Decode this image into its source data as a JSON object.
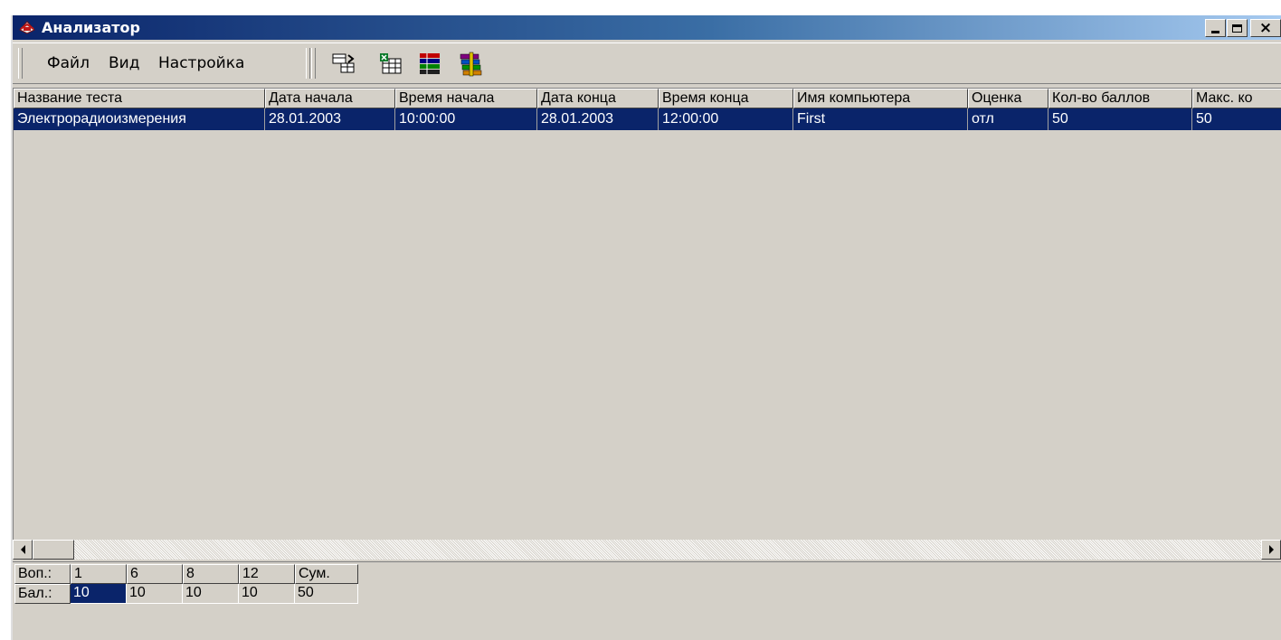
{
  "window": {
    "title": "Анализатор"
  },
  "menu": [
    {
      "label": "Файл"
    },
    {
      "label": "Вид"
    },
    {
      "label": "Настройка"
    }
  ],
  "toolbar_icons": [
    "import-table-icon",
    "export-excel-icon",
    "color-bars-icon",
    "archive-stack-icon"
  ],
  "table": {
    "columns": [
      "Название теста",
      "Дата начала",
      "Время начала",
      "Дата конца",
      "Время конца",
      "Имя компьютера",
      "Оценка",
      "Кол-во баллов",
      "Макс. ко"
    ],
    "rows": [
      [
        "Электрорадиоизмерения",
        "28.01.2003",
        "10:00:00",
        "28.01.2003",
        "12:00:00",
        "First",
        "отл",
        "50",
        "50"
      ]
    ],
    "selected_row": 0
  },
  "score_grid": {
    "questions_label": "Воп.:",
    "questions": [
      "1",
      "6",
      "8",
      "12",
      "Сум."
    ],
    "points_label": "Бал.:",
    "points": [
      "10",
      "10",
      "10",
      "10",
      "50"
    ]
  },
  "colors": {
    "selection": "#0a246a",
    "face": "#d4d0c8",
    "title_gradient_start": "#0a246a",
    "title_gradient_end": "#a6caf0"
  }
}
